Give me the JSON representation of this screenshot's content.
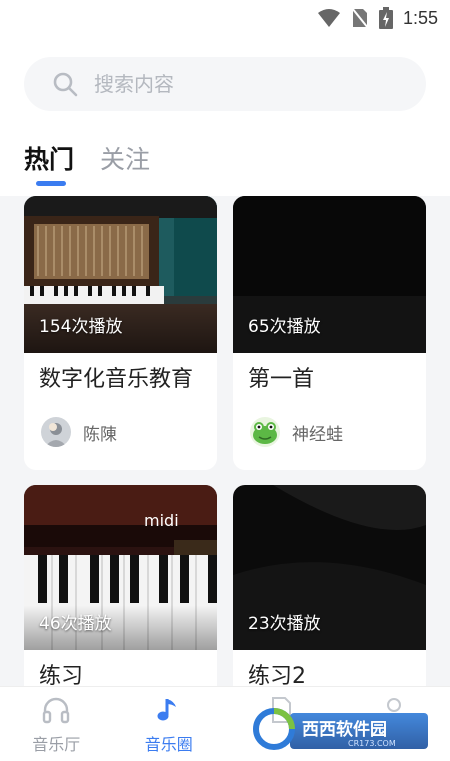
{
  "status_bar": {
    "time": "1:55"
  },
  "search": {
    "placeholder": "搜索内容",
    "value": ""
  },
  "tabs": [
    {
      "label": "热门",
      "active": true
    },
    {
      "label": "关注",
      "active": false
    }
  ],
  "cards": [
    {
      "title": "数字化音乐教育",
      "play_count": "154次播放",
      "author": "陈陳",
      "thumb_overlay": ""
    },
    {
      "title": "第一首",
      "play_count": "65次播放",
      "author": "神经蛙",
      "thumb_overlay": ""
    },
    {
      "title": "练习",
      "play_count": "46次播放",
      "author": "",
      "thumb_overlay": "midi"
    },
    {
      "title": "练习2",
      "play_count": "23次播放",
      "author": "",
      "thumb_overlay": ""
    }
  ],
  "bottom_nav": [
    {
      "label": "音乐厅",
      "icon": "headphones-icon",
      "active": false
    },
    {
      "label": "音乐圈",
      "icon": "music-note-icon",
      "active": true
    },
    {
      "label": "",
      "icon": "document-icon",
      "active": false
    },
    {
      "label": "",
      "icon": "profile-icon",
      "active": false
    }
  ],
  "watermark": {
    "brand": "西西软件园",
    "url": "CR173.COM"
  },
  "colors": {
    "accent": "#3b7cf0",
    "feed_background": "#f4f5f7"
  }
}
